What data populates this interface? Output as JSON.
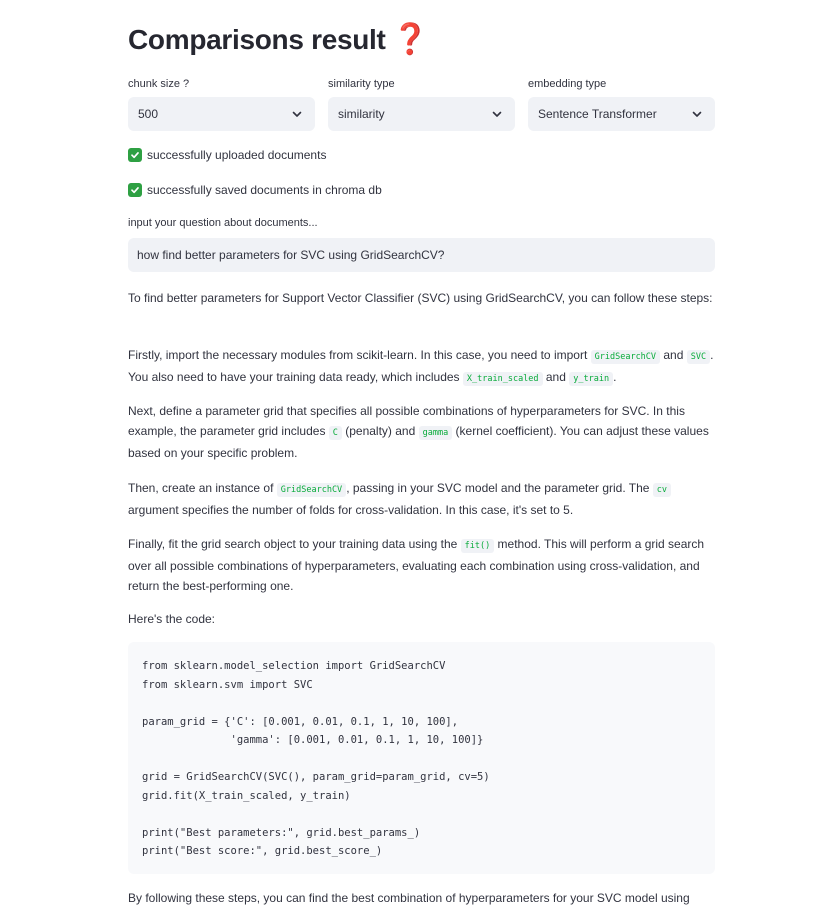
{
  "header": {
    "title": "Comparisons result",
    "title_icon": "red-question-mark"
  },
  "selects": [
    {
      "label": "chunk size ?",
      "value": "500"
    },
    {
      "label": "similarity type",
      "value": "similarity"
    },
    {
      "label": "embedding type",
      "value": "Sentence Transformer"
    }
  ],
  "status": [
    {
      "text": "successfully uploaded documents"
    },
    {
      "text": "successfully saved documents in chroma db"
    }
  ],
  "question": {
    "label": "input your question about documents...",
    "value": "how find better parameters for SVC using GridSearchCV?"
  },
  "answer": {
    "p1": "To find better parameters for Support Vector Classifier (SVC) using GridSearchCV, you can follow these steps:",
    "p2": {
      "t1": "Firstly, import the necessary modules from scikit-learn. In this case, you need to import ",
      "c1": "GridSearchCV",
      "t2": " and ",
      "c2": "SVC",
      "t3": ". You also need to have your training data ready, which includes ",
      "c3": "X_train_scaled",
      "t4": " and ",
      "c4": "y_train",
      "t5": "."
    },
    "p3": {
      "t1": "Next, define a parameter grid that specifies all possible combinations of hyperparameters for SVC. In this example, the parameter grid includes ",
      "c1": "C",
      "t2": " (penalty) and ",
      "c2": "gamma",
      "t3": " (kernel coefficient). You can adjust these values based on your specific problem."
    },
    "p4": {
      "t1": "Then, create an instance of ",
      "c1": "GridSearchCV",
      "t2": ", passing in your SVC model and the parameter grid. The ",
      "c2": "cv",
      "t3": " argument specifies the number of folds for cross-validation. In this case, it's set to 5."
    },
    "p5": {
      "t1": "Finally, fit the grid search object to your training data using the ",
      "c1": "fit()",
      "t2": " method. This will perform a grid search over all possible combinations of hyperparameters, evaluating each combination using cross-validation, and return the best-performing one."
    },
    "p6": "Here's the code:",
    "code": "from sklearn.model_selection import GridSearchCV\nfrom sklearn.svm import SVC\n\nparam_grid = {'C': [0.001, 0.01, 0.1, 1, 10, 100],\n              'gamma': [0.001, 0.01, 0.1, 1, 10, 100]}\n\ngrid = GridSearchCV(SVC(), param_grid=param_grid, cv=5)\ngrid.fit(X_train_scaled, y_train)\n\nprint(\"Best parameters:\", grid.best_params_)\nprint(\"Best score:\", grid.best_score_)",
    "p7": "By following these steps, you can find the best combination of hyperparameters for your SVC model using"
  },
  "colors": {
    "accent_green": "#2ea043",
    "code_green": "#09ab3b",
    "question_red": "#e23b2e",
    "field_bg": "#f0f2f6"
  }
}
